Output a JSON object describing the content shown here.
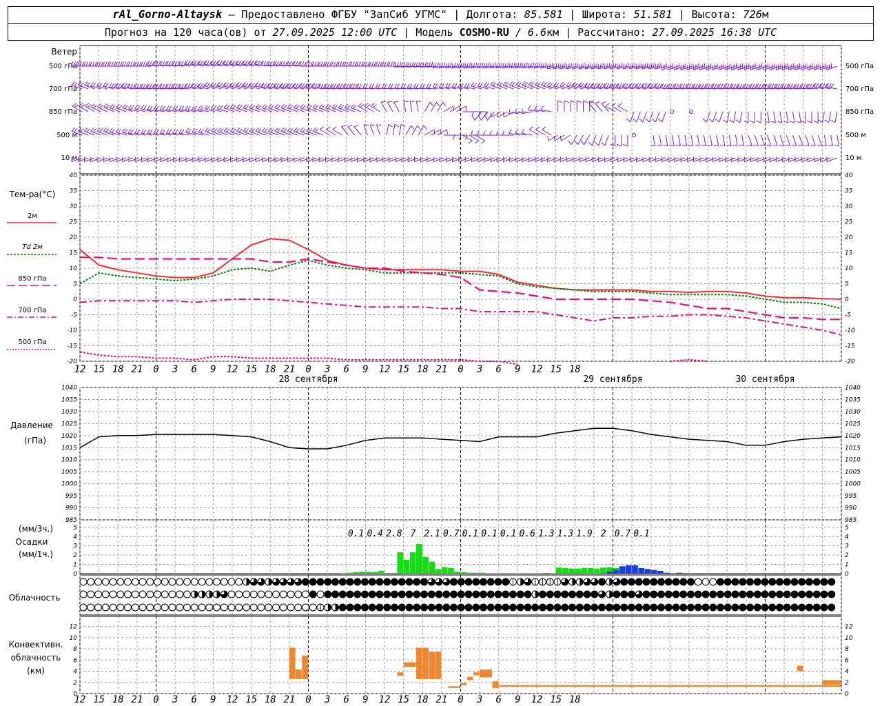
{
  "header": {
    "station": "rAl_Gorno-Altaysk",
    "provider": " – Предоставлено ФГБУ \"ЗапСиб УГМС\" | Долгота: ",
    "lon": "85.581",
    "lat_label": " | Широта: ",
    "lat": "51.581",
    "alt_label": " | Высота: ",
    "alt": "726",
    "alt_unit": "м",
    "line2_a": "Прогноз на 120 часа(ов) от ",
    "init": "27.09.2025 12:00 UTC",
    "line2_b": "  | Модель ",
    "model": "COSMO-RU",
    "res": " / 6.6",
    "res_unit": "км",
    "line2_c": " | Рассчитано: ",
    "calc": "27.09.2025 16:38 UTC"
  },
  "labels": {
    "wind": "Ветер",
    "wind_levels": [
      "500 гПа",
      "700 гПа",
      "850 гПа",
      "500 м",
      "10  м"
    ],
    "temp_title": "Тем-ра(°C)",
    "temp_legend": [
      "2м",
      "Td  2м",
      "850 гПа",
      "700 гПа",
      "500 гПа"
    ],
    "pressure_title": "Давление",
    "pressure_unit": "(гПа)",
    "precip_unit_3h": "(мм/3ч.)",
    "precip_title": "Осадки",
    "precip_unit_1h": "(мм/1ч.)",
    "cloud_title": "Облачность",
    "conv_title": [
      "Конвективн.",
      "облачность",
      "(км)"
    ]
  },
  "colors": {
    "wind": "#7a1fc8",
    "t2m": "#ee3030",
    "td2m": "#0a7a0a",
    "t850": "#e0107a",
    "t700": "#e0107a",
    "t500": "#e0107a",
    "pressure": "#000000",
    "rain": "#16dc16",
    "snow": "#1a3ee0",
    "conv": "#ee8830"
  },
  "chart_data": [
    {
      "type": "line",
      "title": "Тем-ра(°C)",
      "x_ticks": [
        "12",
        "15",
        "18",
        "21",
        "0",
        "3",
        "6",
        "9",
        "12",
        "15",
        "18",
        "21",
        "0",
        "3",
        "6",
        "9",
        "12",
        "15",
        "18",
        "21",
        "0",
        "3",
        "6",
        "9",
        "12",
        "15",
        "18"
      ],
      "day_labels": [
        "28 сентября",
        "29 сентября",
        "30 сентября"
      ],
      "ylim": [
        -20,
        40
      ],
      "yticks": [
        -20,
        -15,
        -10,
        -5,
        0,
        5,
        10,
        15,
        20,
        25,
        30,
        35,
        40
      ],
      "x_hours": [
        0,
        3,
        6,
        9,
        12,
        15,
        18,
        21,
        24,
        27,
        30,
        33,
        36,
        39,
        42,
        45,
        48,
        51,
        54,
        57,
        60,
        63,
        66,
        69,
        72,
        75,
        78,
        81,
        84,
        87,
        90,
        93,
        96,
        99,
        102,
        105,
        108,
        111,
        114,
        117,
        120
      ],
      "series": [
        {
          "name": "2м",
          "values": [
            16,
            11,
            9.5,
            8.5,
            7.5,
            7,
            7,
            8.5,
            13,
            17.5,
            19.5,
            19,
            16,
            12.5,
            11,
            10,
            9.5,
            9.5,
            9.5,
            9.5,
            9,
            9,
            8,
            5.5,
            4.5,
            3.5,
            3,
            3,
            3,
            3,
            2.5,
            2.5,
            2.2,
            2.5,
            2.5,
            2,
            1,
            0.5,
            0.5,
            0.2,
            0
          ]
        },
        {
          "name": "Td  2м",
          "values": [
            5,
            8.5,
            7.5,
            7,
            6.5,
            6,
            6.5,
            7.5,
            9.5,
            10,
            9,
            11,
            12.5,
            11,
            10,
            9.5,
            8.5,
            8.5,
            8.5,
            8.5,
            8.5,
            8,
            7.5,
            5,
            4,
            3.5,
            3,
            2.5,
            2.5,
            2.5,
            2,
            1.5,
            1.5,
            1.5,
            1.5,
            1,
            0,
            -1,
            -1,
            -1.5,
            -3
          ]
        },
        {
          "name": "850 гПа",
          "values": [
            13.5,
            13.5,
            13,
            13,
            13,
            13,
            13,
            13,
            13,
            13,
            12,
            12,
            13,
            12,
            11,
            10,
            10,
            9,
            8.5,
            8,
            7,
            3,
            2.5,
            2,
            1,
            0,
            0,
            0,
            0,
            0,
            -0.5,
            -1,
            -2,
            -3,
            -3,
            -4,
            -5,
            -6,
            -6,
            -6.5,
            -6.5
          ]
        },
        {
          "name": "700 гПа",
          "values": [
            -1,
            -0.5,
            -0.5,
            -0.5,
            -0.5,
            -0.5,
            -1,
            -0.5,
            0,
            0,
            0,
            -0.5,
            -1,
            -1.5,
            -2,
            -2.5,
            -2.5,
            -2.5,
            -2.5,
            -3,
            -3,
            -4,
            -4,
            -4,
            -4,
            -5,
            -6,
            -7,
            -6,
            -6,
            -5.5,
            -5.5,
            -5,
            -5,
            -5.5,
            -6,
            -7,
            -8,
            -9,
            -10,
            -11.5
          ]
        },
        {
          "name": "500 гПа",
          "values": [
            -17,
            -18,
            -18.5,
            -18.5,
            -19,
            -19,
            -19.5,
            -18.5,
            -18.5,
            -19,
            -19,
            -19,
            -19,
            -19,
            -19.5,
            -19.5,
            -19.5,
            -19.5,
            -19.5,
            -19.5,
            -19.5,
            -20,
            -20,
            -21,
            null,
            null,
            null,
            null,
            null,
            null,
            null,
            -20,
            -19.5,
            -20,
            null,
            null,
            null,
            null,
            null,
            null,
            null
          ]
        }
      ]
    },
    {
      "type": "line",
      "title": "Давление",
      "ylim": [
        985,
        1040
      ],
      "yticks": [
        985,
        990,
        995,
        1000,
        1005,
        1010,
        1015,
        1020,
        1025,
        1030,
        1035,
        1040
      ],
      "x_hours": [
        0,
        3,
        6,
        9,
        12,
        15,
        18,
        21,
        24,
        27,
        30,
        33,
        36,
        39,
        42,
        45,
        48,
        51,
        54,
        57,
        60,
        63,
        66,
        69,
        72,
        75,
        78,
        81,
        84,
        87,
        90,
        93,
        96,
        99,
        102,
        105,
        108,
        111,
        114,
        117,
        120
      ],
      "series": [
        {
          "name": "Давление",
          "values": [
            1015,
            1019.5,
            1020,
            1020,
            1020.5,
            1020.5,
            1020.5,
            1020.5,
            1020,
            1019.5,
            1017.5,
            1015,
            1014.5,
            1014.5,
            1016,
            1018,
            1019,
            1019,
            1019,
            1018.5,
            1018,
            1017.5,
            1019.5,
            1019.5,
            1019.5,
            1021,
            1022,
            1023,
            1023,
            1022,
            1020.5,
            1019.5,
            1018.5,
            1018,
            1017.5,
            1016,
            1016,
            1017.5,
            1018.5,
            1019,
            1019.5
          ]
        }
      ]
    },
    {
      "type": "bar",
      "title": "Осадки",
      "ylim": [
        0,
        5
      ],
      "sums_3h": [
        "0.1",
        "0.4",
        "2.8",
        "7",
        "2.1",
        "0.7",
        "0.1",
        "0.1",
        "0.1",
        "0.6",
        "1.3",
        "1.3",
        "1.9",
        "2",
        "0.7",
        "0.1"
      ],
      "sums_x_hours": [
        43.5,
        46.5,
        49.5,
        52.5,
        55.5,
        58.5,
        61.5,
        64.5,
        67.5,
        70.5,
        73.5,
        76.5,
        79.5,
        82.5,
        85.5,
        88.5
      ],
      "hourly_start_hour": 41,
      "rain": [
        0.05,
        0.1,
        0.15,
        0.2,
        0.2,
        0.15,
        0.3,
        0,
        0,
        2.3,
        1.5,
        2.3,
        3.2,
        1.8,
        1.3,
        0.5,
        0.7,
        0.6,
        0.2,
        0.15,
        0.1,
        0.1,
        0.1,
        0.05,
        0.05,
        0.05,
        0.05,
        0.05,
        0.05,
        0.05,
        0.05,
        0.05,
        0,
        0.05,
        0.65,
        0.6,
        0.55,
        0.55,
        0.6,
        0.6,
        0.55,
        0.65,
        0.7,
        0.6,
        0.3,
        0.1,
        0,
        0,
        0,
        0,
        0,
        0,
        0,
        0
      ],
      "snow": [
        0,
        0,
        0,
        0,
        0,
        0,
        0,
        0,
        0,
        0,
        0,
        0,
        0,
        0,
        0,
        0,
        0,
        0,
        0,
        0,
        0,
        0,
        0,
        0,
        0,
        0,
        0,
        0,
        0,
        0,
        0,
        0,
        0,
        0,
        0,
        0,
        0,
        0,
        0,
        0,
        0,
        0,
        0.2,
        0.4,
        0.8,
        0.9,
        0.9,
        0.6,
        0.5,
        0.4,
        0.3,
        0.1,
        0.05,
        0.1
      ]
    },
    {
      "type": "bar",
      "title": "Конвективн. облачность (км)",
      "ylim": [
        0,
        13
      ],
      "yticks": [
        0,
        2,
        4,
        6,
        8,
        10,
        12
      ],
      "bars": [
        {
          "h0": 33,
          "h1": 34,
          "base": 2.6,
          "top": 8.2
        },
        {
          "h0": 34,
          "h1": 35,
          "base": 2.6,
          "top": 4.3
        },
        {
          "h0": 35,
          "h1": 36,
          "base": 2.6,
          "top": 6.8
        },
        {
          "h0": 50,
          "h1": 51,
          "base": 3.2,
          "top": 3.8
        },
        {
          "h0": 51,
          "h1": 53,
          "base": 4.8,
          "top": 5.6
        },
        {
          "h0": 53,
          "h1": 54,
          "base": 2.6,
          "top": 8.2
        },
        {
          "h0": 54,
          "h1": 55,
          "base": 2.6,
          "top": 8.2
        },
        {
          "h0": 55,
          "h1": 56,
          "base": 2.6,
          "top": 7.5
        },
        {
          "h0": 56,
          "h1": 57,
          "base": 2.6,
          "top": 7.5
        },
        {
          "h0": 58,
          "h1": 60,
          "base": 1.0,
          "top": 1.3
        },
        {
          "h0": 60,
          "h1": 61,
          "base": 1.5,
          "top": 1.9
        },
        {
          "h0": 61,
          "h1": 62,
          "base": 2.4,
          "top": 3.0
        },
        {
          "h0": 62,
          "h1": 63,
          "base": 3.3,
          "top": 3.8
        },
        {
          "h0": 63,
          "h1": 65,
          "base": 2.9,
          "top": 4.3
        },
        {
          "h0": 65,
          "h1": 66,
          "base": 1.0,
          "top": 2.2
        },
        {
          "h0": 66,
          "h1": 120,
          "base": 1.2,
          "top": 1.5
        },
        {
          "h0": 113,
          "h1": 114,
          "base": 4.0,
          "top": 5.0
        },
        {
          "h0": 117,
          "h1": 120,
          "base": 1.6,
          "top": 2.4
        }
      ]
    }
  ],
  "cloud_rows": [
    "000000000000000000000023323333444444444444444443334444444412311113223342344444444440004444444444444444",
    "000000000000000222230000000000040444444444444444444444444444424444444432444344444444444444444444444444",
    "000000000000000000000000000000001224444444444444444444444444444444444444444444444444444444444444444444"
  ],
  "winds": [
    {
      "level": "500 гПа",
      "dirs": [
        270,
        270,
        270,
        270,
        275,
        275,
        280,
        280,
        280,
        280,
        275,
        275,
        270,
        270,
        270,
        270,
        270,
        265,
        265,
        260,
        260,
        260,
        260,
        260,
        260,
        255,
        255,
        255,
        255,
        255,
        255,
        250,
        250,
        250,
        250,
        250,
        250,
        250,
        250,
        250,
        250
      ],
      "speeds": [
        25,
        25,
        25,
        25,
        30,
        30,
        30,
        30,
        30,
        30,
        30,
        30,
        30,
        30,
        30,
        30,
        30,
        30,
        30,
        30,
        25,
        25,
        25,
        25,
        25,
        25,
        25,
        25,
        25,
        25,
        25,
        25,
        25,
        25,
        30,
        30,
        30,
        30,
        30,
        30,
        30
      ]
    },
    {
      "level": "700 гПа",
      "dirs": [
        290,
        285,
        280,
        275,
        275,
        275,
        280,
        285,
        285,
        285,
        280,
        280,
        280,
        275,
        275,
        275,
        275,
        275,
        275,
        280,
        280,
        285,
        290,
        290,
        290,
        285,
        285,
        280,
        280,
        280,
        280,
        275,
        275,
        275,
        275,
        275,
        275,
        275,
        275,
        280,
        280
      ],
      "speeds": [
        20,
        20,
        25,
        25,
        25,
        25,
        25,
        25,
        25,
        25,
        25,
        25,
        25,
        25,
        25,
        20,
        20,
        20,
        20,
        20,
        20,
        15,
        15,
        20,
        20,
        20,
        25,
        25,
        25,
        25,
        25,
        25,
        25,
        25,
        25,
        25,
        25,
        25,
        25,
        25,
        25
      ]
    },
    {
      "level": "850 гПа",
      "dirs": [
        300,
        295,
        290,
        285,
        280,
        280,
        280,
        285,
        290,
        290,
        290,
        290,
        290,
        290,
        290,
        300,
        330,
        350,
        30,
        60,
        90,
        220,
        240,
        260,
        280,
        0,
        0,
        320,
        300,
        200,
        200,
        0,
        0,
        200,
        190,
        180,
        170,
        170,
        180,
        190,
        200
      ],
      "speeds": [
        15,
        15,
        15,
        15,
        15,
        15,
        15,
        15,
        15,
        15,
        15,
        15,
        15,
        15,
        15,
        15,
        10,
        10,
        10,
        10,
        10,
        10,
        10,
        10,
        10,
        5,
        5,
        5,
        5,
        5,
        5,
        0,
        0,
        10,
        10,
        10,
        10,
        10,
        10,
        10,
        10
      ]
    },
    {
      "level": "500 м",
      "dirs": [
        290,
        290,
        285,
        280,
        280,
        280,
        285,
        290,
        290,
        290,
        290,
        290,
        290,
        300,
        320,
        340,
        10,
        30,
        60,
        90,
        120,
        270,
        270,
        280,
        300,
        240,
        210,
        200,
        180,
        0,
        170,
        170,
        170,
        170,
        170,
        160,
        160,
        160,
        160,
        170,
        170
      ],
      "speeds": [
        15,
        15,
        15,
        15,
        15,
        15,
        15,
        15,
        15,
        15,
        15,
        15,
        15,
        10,
        10,
        10,
        10,
        10,
        10,
        10,
        10,
        10,
        10,
        10,
        10,
        5,
        5,
        5,
        5,
        0,
        5,
        5,
        5,
        5,
        5,
        5,
        5,
        5,
        5,
        5,
        5
      ]
    },
    {
      "level": "10  м",
      "dirs": [
        250,
        250,
        250,
        250,
        250,
        250,
        250,
        250,
        250,
        250,
        250,
        250,
        250,
        250,
        250,
        250,
        250,
        250,
        250,
        250,
        250,
        250,
        250,
        250,
        250,
        250,
        250,
        250,
        250,
        250,
        250,
        250,
        250,
        250,
        250,
        250,
        250,
        250,
        250,
        250,
        250
      ],
      "speeds": [
        10,
        10,
        10,
        10,
        10,
        10,
        10,
        10,
        10,
        10,
        10,
        10,
        10,
        10,
        10,
        10,
        10,
        10,
        10,
        10,
        10,
        10,
        10,
        10,
        10,
        5,
        5,
        5,
        5,
        5,
        5,
        5,
        5,
        5,
        5,
        5,
        5,
        5,
        5,
        5,
        5
      ]
    }
  ]
}
